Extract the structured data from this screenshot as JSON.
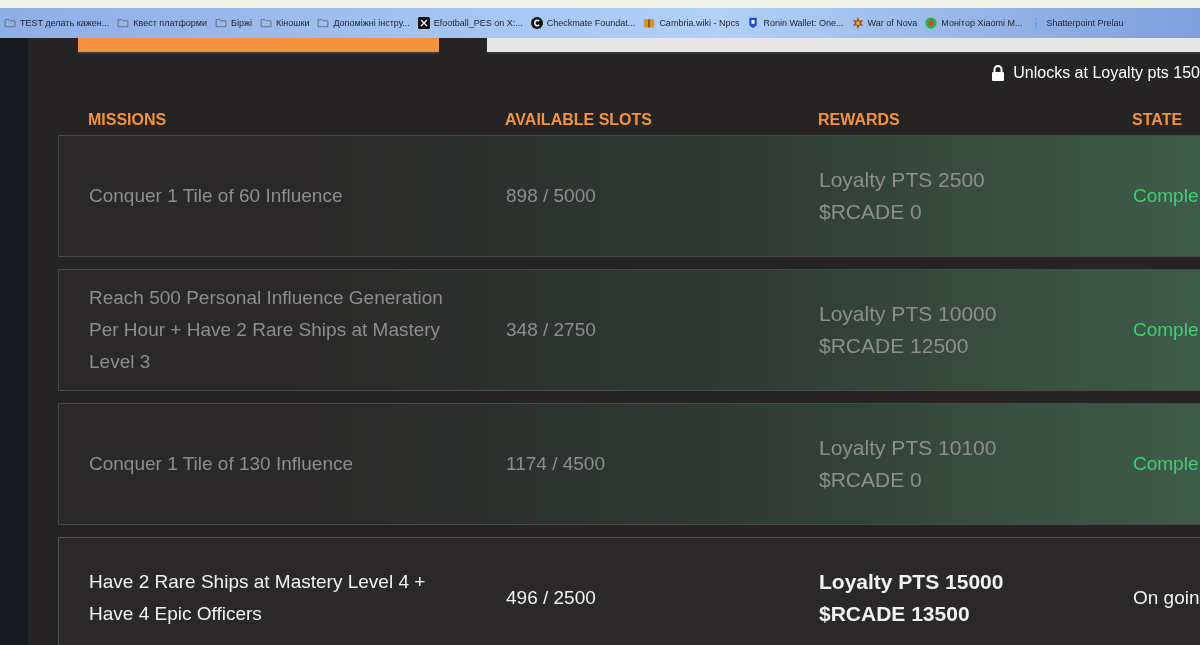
{
  "bookmarks": [
    {
      "label": "TEST делать кажен...",
      "kind": "folder"
    },
    {
      "label": "Квест платформи",
      "kind": "folder"
    },
    {
      "label": "Біржі",
      "kind": "folder"
    },
    {
      "label": "Кіношки",
      "kind": "folder"
    },
    {
      "label": "Допоміжні інстру...",
      "kind": "folder"
    },
    {
      "label": "Efootball_PES on X:...",
      "kind": "x"
    },
    {
      "label": "Checkmate Foundat...",
      "kind": "c"
    },
    {
      "label": "Cambria.wiki - Npcs",
      "kind": "chest"
    },
    {
      "label": "Ronin Wallet: One...",
      "kind": "shield"
    },
    {
      "label": "War of Nova",
      "kind": "star"
    },
    {
      "label": "Монітор Xiaomi M...",
      "kind": "dot"
    },
    {
      "label": "Shatterpoint Prelau",
      "kind": "figure"
    }
  ],
  "tabs": [
    {
      "selected": true
    },
    {
      "selected": false
    }
  ],
  "unlock_note": "Unlocks at Loyalty pts 150",
  "table": {
    "columns": [
      "MISSIONS",
      "AVAILABLE SLOTS",
      "REWARDS",
      "STATE"
    ],
    "rows": [
      {
        "mission": "Conquer 1 Tile of 60 Influence",
        "slots": "898 / 5000",
        "rewards": [
          "Loyalty PTS 2500",
          "$RCADE 0"
        ],
        "state": "Comple",
        "completed": true
      },
      {
        "mission": "Reach 500 Personal Influence Generation Per Hour + Have 2 Rare Ships at Mastery Level 3",
        "slots": "348 / 2750",
        "rewards": [
          "Loyalty PTS 10000",
          "$RCADE 12500"
        ],
        "state": "Comple",
        "completed": true
      },
      {
        "mission": "Conquer 1 Tile of 130 Influence",
        "slots": "1174 / 4500",
        "rewards": [
          "Loyalty PTS 10100",
          "$RCADE 0"
        ],
        "state": "Comple",
        "completed": true
      },
      {
        "mission": "Have 2 Rare Ships at Mastery Level 4 + Have 4 Epic Officers",
        "slots": "496 / 2500",
        "rewards": [
          "Loyalty PTS 15000",
          "$RCADE 13500"
        ],
        "state": "On goin",
        "completed": false
      }
    ]
  }
}
